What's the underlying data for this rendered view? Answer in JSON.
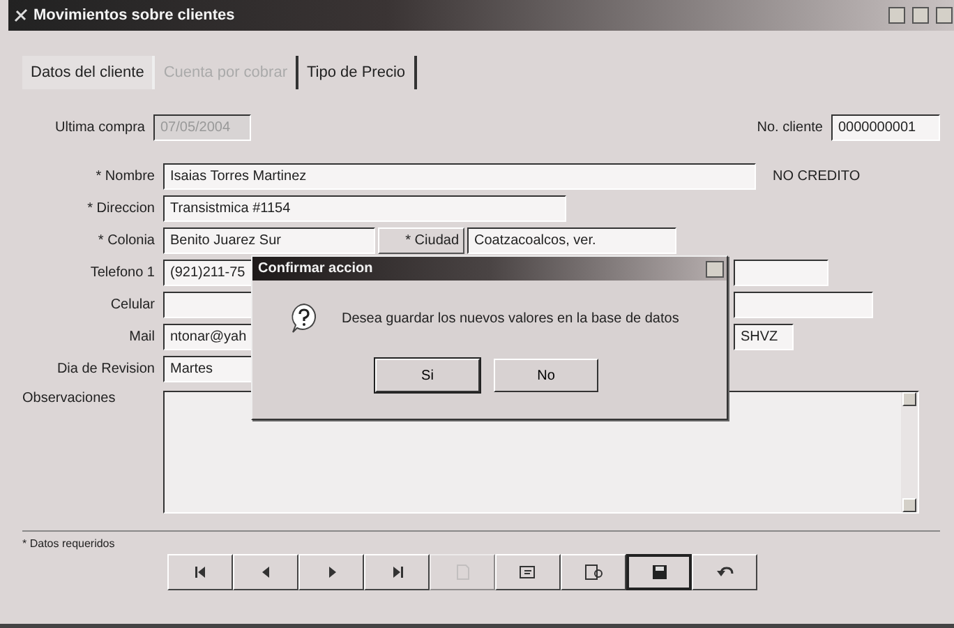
{
  "window": {
    "title": "Movimientos sobre clientes"
  },
  "tabs": [
    {
      "label": "Datos del cliente",
      "selected": true,
      "disabled": false
    },
    {
      "label": "Cuenta por cobrar",
      "selected": false,
      "disabled": true
    },
    {
      "label": "Tipo de Precio",
      "selected": false,
      "disabled": false
    }
  ],
  "last_purchase": {
    "label": "Ultima compra",
    "value": "07/05/2004",
    "disabled": true
  },
  "client_no": {
    "label": "No. cliente",
    "value": "0000000001"
  },
  "fields": [
    {
      "kind": "full",
      "label": "* Nombre",
      "value": "Isaias Torres Martinez",
      "note": "NO CREDITO"
    },
    {
      "kind": "full",
      "label": "* Direccion",
      "value": "Transistmica #1154"
    },
    {
      "kind": "city",
      "label": "* Colonia",
      "value": "Benito Juarez Sur",
      "city_label": "* Ciudad",
      "city_value": "Coatzacoalcos, ver."
    },
    {
      "kind": "split",
      "label": "Telefono 1",
      "value": "(921)211-75"
    },
    {
      "kind": "split",
      "label": "Celular"
    },
    {
      "kind": "split",
      "label": "Mail",
      "value": "ntonar@yah",
      "right_value": "SHVZ"
    },
    {
      "kind": "split",
      "label": "Dia de Revision",
      "value": "Martes"
    }
  ],
  "notes": {
    "label": "Observaciones"
  },
  "dialog": {
    "title": "Confirmar accion",
    "message": "Desea guardar los nuevos valores en la base de datos",
    "buttons": [
      "Si",
      "No"
    ]
  },
  "status": "* Datos requeridos",
  "nav_buttons": [
    {
      "kind": "first",
      "disabled": false,
      "pressed": false
    },
    {
      "kind": "prev",
      "disabled": false,
      "pressed": false
    },
    {
      "kind": "next",
      "disabled": false,
      "pressed": false
    },
    {
      "kind": "last",
      "disabled": false,
      "pressed": false
    },
    {
      "kind": "new",
      "disabled": true,
      "pressed": false
    },
    {
      "kind": "edit",
      "disabled": false,
      "pressed": false
    },
    {
      "kind": "search",
      "disabled": false,
      "pressed": false
    },
    {
      "kind": "save",
      "disabled": false,
      "pressed": true
    },
    {
      "kind": "undo",
      "disabled": false,
      "pressed": false
    }
  ]
}
